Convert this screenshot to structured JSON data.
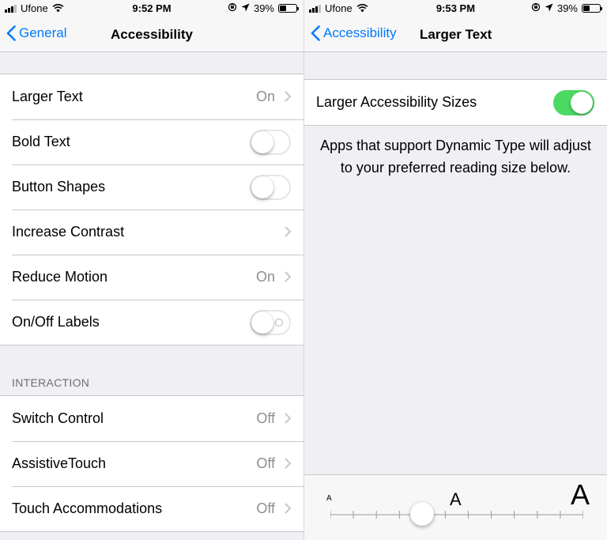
{
  "left": {
    "status": {
      "carrier": "Ufone",
      "time": "9:52 PM",
      "battery": "39%",
      "battery_level": 0.39
    },
    "nav": {
      "back_label": "General",
      "title": "Accessibility"
    },
    "rows": [
      {
        "label": "Larger Text",
        "value": "On"
      },
      {
        "label": "Bold Text",
        "toggle": false
      },
      {
        "label": "Button Shapes",
        "toggle": false
      },
      {
        "label": "Increase Contrast"
      },
      {
        "label": "Reduce Motion",
        "value": "On"
      },
      {
        "label": "On/Off Labels",
        "toggle": false
      }
    ],
    "interaction": {
      "header": "INTERACTION",
      "rows": [
        {
          "label": "Switch Control",
          "value": "Off"
        },
        {
          "label": "AssistiveTouch",
          "value": "Off"
        },
        {
          "label": "Touch Accommodations",
          "value": "Off"
        }
      ]
    }
  },
  "right": {
    "status": {
      "carrier": "Ufone",
      "time": "9:53 PM",
      "battery": "39%",
      "battery_level": 0.39
    },
    "nav": {
      "back_label": "Accessibility",
      "title": "Larger Text"
    },
    "larger_sizes": {
      "label": "Larger Accessibility Sizes",
      "toggle": true
    },
    "info": "Apps that support Dynamic Type will adjust to your preferred reading size below.",
    "slider": {
      "small_label": "A",
      "medium_label": "A",
      "large_label": "A",
      "steps": 12,
      "position": 4
    }
  },
  "colors": {
    "accent": "#007aff",
    "toggle_on": "#4cd964",
    "secondary_text": "#8e8e93",
    "background": "#efeff4"
  }
}
